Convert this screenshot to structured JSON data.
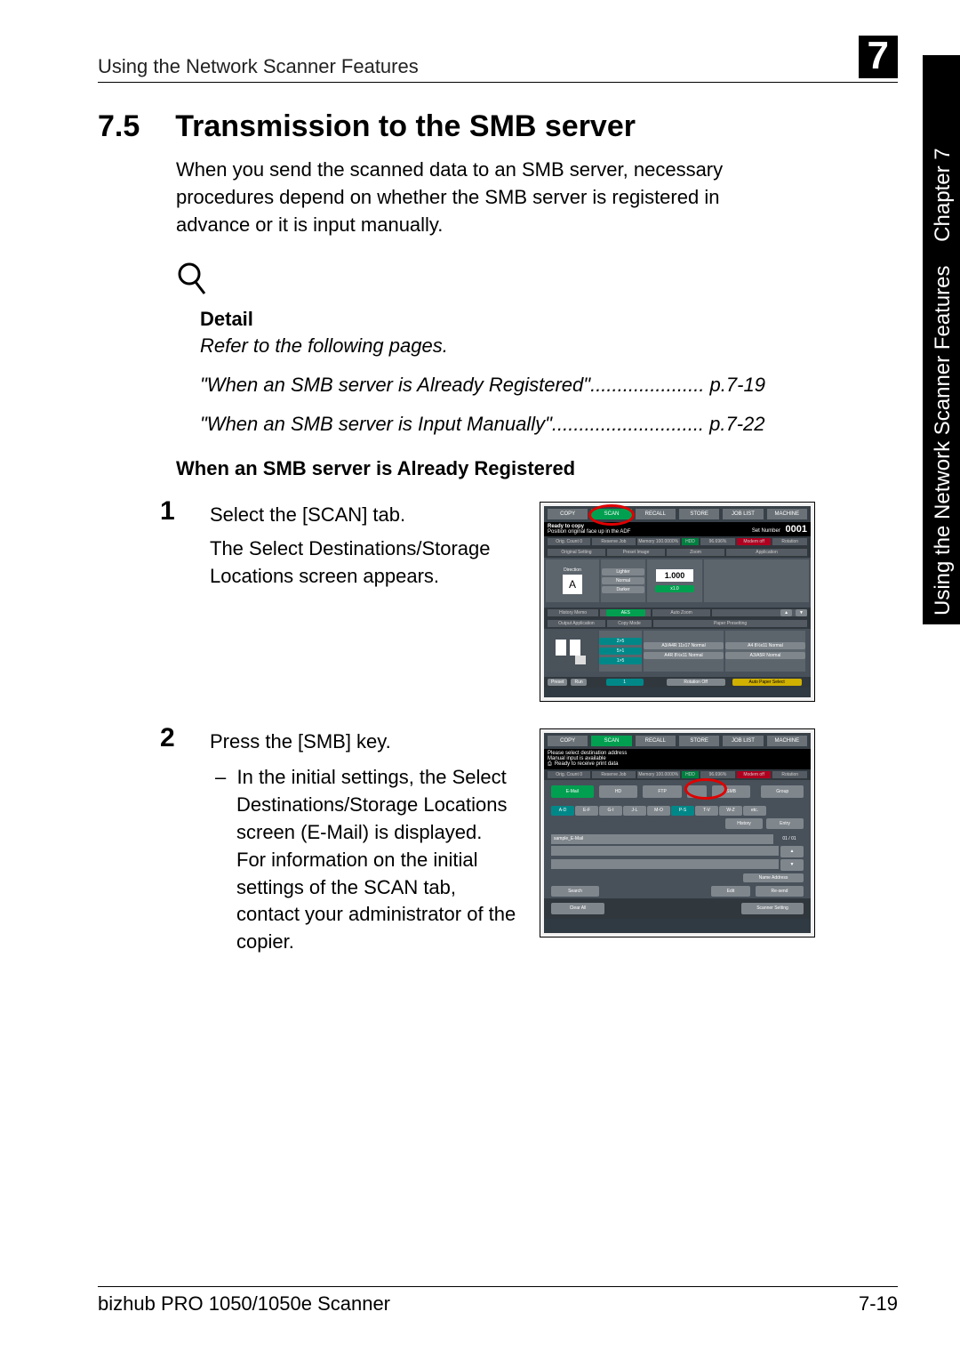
{
  "header": {
    "title": "Using the Network Scanner Features",
    "chapter_number": "7"
  },
  "side_tab": {
    "chapter": "Chapter 7",
    "label": "Using the Network Scanner Features"
  },
  "section": {
    "number": "7.5",
    "title": "Transmission to the SMB server",
    "intro": "When you send the scanned data to an SMB server, necessary procedures depend on whether the SMB server is registered in advance or it is input manually."
  },
  "detail": {
    "label": "Detail",
    "refer": "Refer to the following pages.",
    "line1": "\"When an SMB server is Already Registered\"..................... p.7-19",
    "line2": "\"When an SMB server is Input Manually\"............................ p.7-22"
  },
  "subheading": "When an SMB server is Already Registered",
  "steps": [
    {
      "num": "1",
      "main": "Select the [SCAN] tab.",
      "extra": "The Select Destinations/Storage Locations screen appears."
    },
    {
      "num": "2",
      "main": "Press the [SMB] key.",
      "sub_prefix": "–",
      "sub": "In the initial settings, the Select Destinations/Storage Loca­tions screen (E-Mail) is dis­played. For information on the initial settings of the SCAN tab, contact your administrator of the copier."
    }
  ],
  "shot1": {
    "tabs": [
      "COPY",
      "SCAN",
      "RECALL",
      "STORE",
      "JOB LIST",
      "MACHINE"
    ],
    "status_l": "Ready to copy",
    "status_sub": "Position original face up in the ADF",
    "set_label": "Set Number",
    "set_value": "0001",
    "bar": [
      "Orig. Count  0",
      "Reserve Job",
      "Memory  100.0000%",
      "HDD",
      "96.696%",
      "Modem off",
      "Rotation"
    ],
    "row_labels": [
      "Original Setting",
      "Preset Image",
      "Zoom",
      "Application"
    ],
    "direction_label": "Direction",
    "direction_val": "A",
    "img_opts": [
      "Lighter",
      "Normal",
      "Darker"
    ],
    "zoom_main": "1.000",
    "zoom_sub": "x1.0",
    "rd_label": "History Memo",
    "aes": "AES",
    "autozoom": "Auto Zoom",
    "copy_mode": "Copy Mode",
    "paper_pre": "Paper Presetting",
    "papers": [
      "A3/A4R 11x17 Normal",
      "A4R 8½x11 Normal",
      "A4 8½x11 Normal",
      "A3/A5R Normal"
    ],
    "output_app": "Output Application",
    "preset": "Preset",
    "run": "Run",
    "qty": "1",
    "rot": "Rotation Off",
    "auto_paper": "Auto Paper Select"
  },
  "shot2": {
    "tabs": [
      "COPY",
      "SCAN",
      "RECALL",
      "STORE",
      "JOB LIST",
      "MACHINE"
    ],
    "status1": "Please select destination address",
    "status2": "Manual input is available",
    "status3": "Ready to receive print data",
    "bar": [
      "Orig. Count  0",
      "Reserve Job",
      "Memory  100.0000%",
      "HDD",
      "96.696%",
      "Modem off",
      "Rotation"
    ],
    "mode_tabs": [
      "E-Mail",
      "HD",
      "FTP",
      "",
      "SMB",
      "Group"
    ],
    "letter_tabs": [
      "A-D",
      "E-F",
      "G-I",
      "J-L",
      "M-O",
      "P-S",
      "T-V",
      "W-Z",
      "etc."
    ],
    "history": "History",
    "entry": "Entry",
    "sample": "sample_E-Mail",
    "pgcount": "01 / 01",
    "name_addr": "Name  Address",
    "search": "Search",
    "edit": "Edit",
    "re_send": "Re-send",
    "clear": "Clear All",
    "scanset": "Scanner Setting"
  },
  "footer": {
    "left": "bizhub PRO 1050/1050e Scanner",
    "right": "7-19"
  }
}
